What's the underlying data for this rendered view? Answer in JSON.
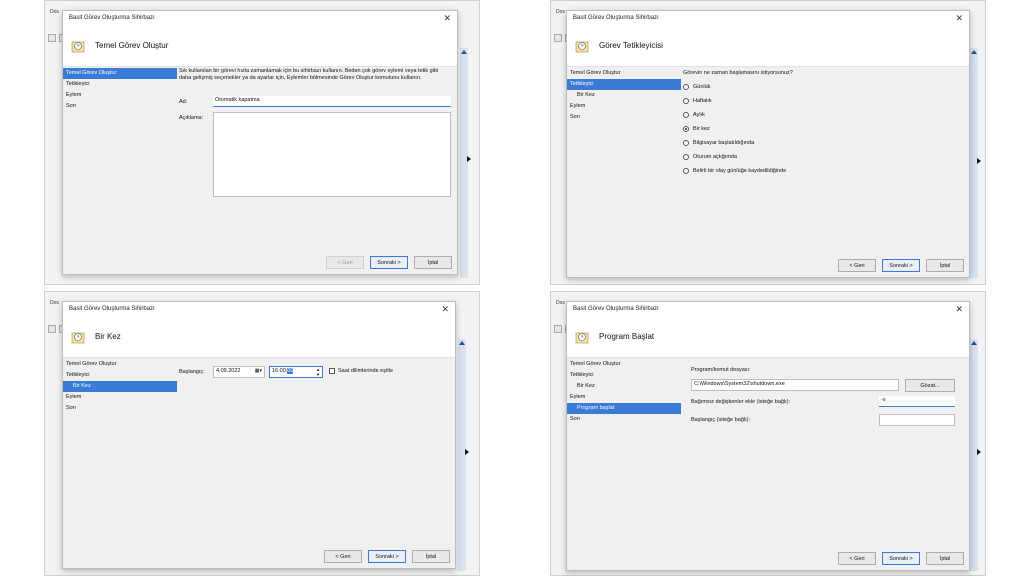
{
  "background_menu": "Dos",
  "wizard_title": "Basit Görev Oluşturma Sihirbazı",
  "nav": {
    "temel": "Temel Görev Oluştur",
    "tetikleyici": "Tetikleyici",
    "bir_kez": "Bir Kez",
    "eylem": "Eylem",
    "program_baslat": "Program başlat",
    "son": "Son"
  },
  "buttons": {
    "back": "< Geri",
    "next": "Sonraki >",
    "cancel": "İptal",
    "browse": "Gözat..."
  },
  "step1": {
    "header": "Temel Görev Oluştur",
    "description": "Sık kullanılan bir görevi hızla zamanlamak için bu sihirbazı kullanın. Beden çok görev eylemi veya tetik gibi daha gelişmiş seçenekler ya da ayarlar için, Eylemler bölmesinde Görev Oluştur komutunu kullanın.",
    "name_label": "Ad:",
    "name_value": "Otomatik kapatma",
    "desc_label": "Açıklama:"
  },
  "step2": {
    "header": "Görev Tetikleyicisi",
    "question": "Görevin ne zaman başlamasını istiyorsunuz?",
    "options": [
      "Günlük",
      "Haftalık",
      "Aylık",
      "Bir kez",
      "Bilgisayar başlatıldığında",
      "Oturum açtığımda",
      "Belirli bir olay günlüğe kaydedildiğinde"
    ]
  },
  "step3": {
    "header": "Bir Kez",
    "start_label": "Başlangıç:",
    "date": "4.09.2022",
    "time_prefix": "16:00:",
    "time_selected": "00",
    "sync_label": "Saat dilimlerinde eşitle"
  },
  "step4": {
    "header": "Program Başlat",
    "program_label": "Program/komut dosyası:",
    "program_value": "C:\\Windows\\System32\\shutdown.exe",
    "args_label": "Bağımsız değişkenler ekle (isteğe bağlı):",
    "args_value": "-s",
    "start_in_label": "Başlangıç (isteğe bağlı):"
  }
}
